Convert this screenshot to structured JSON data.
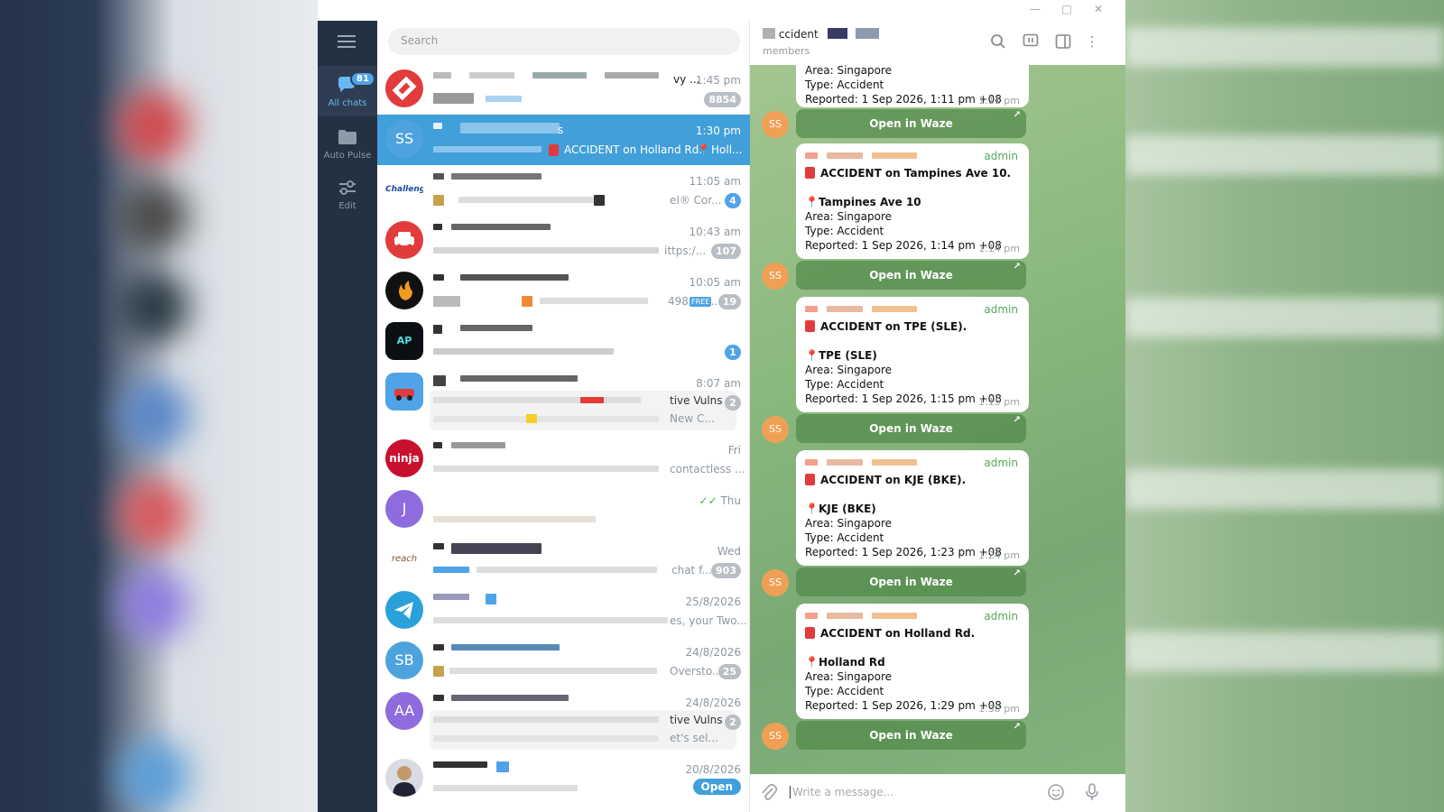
{
  "window": {
    "minimize_icon": "minimize-icon",
    "maximize_icon": "maximize-icon",
    "close_icon": "close-icon"
  },
  "sidebar": {
    "menu_icon": "hamburger-icon",
    "folders": [
      {
        "label": "All chats",
        "badge": "81",
        "icon": "chats-icon",
        "active": true
      },
      {
        "label": "Auto Pulse",
        "icon": "folder-icon"
      },
      {
        "label": "Edit",
        "icon": "sliders-icon"
      }
    ]
  },
  "chatlist": {
    "search_placeholder": "Search",
    "rows": [
      {
        "time": "1:45 pm",
        "preview": "vy ...",
        "unread": "8854"
      },
      {
        "initials": "SS",
        "time": "1:30 pm",
        "name_tail": "s",
        "preview": "ACCIDENT on Holland Rd.",
        "preview2": "Holl...",
        "selected": true
      },
      {
        "time": "11:05 am",
        "preview": "el® Cor...",
        "unread": "4"
      },
      {
        "time": "10:43 am",
        "preview": "ittps:/...",
        "unread": "107"
      },
      {
        "time": "10:05 am",
        "preview": "498",
        "preview2": "...",
        "unread": "19"
      },
      {
        "initials": "AP",
        "time": "",
        "unread": "1"
      },
      {
        "time": "8:07 am",
        "preview": "tive Vulns",
        "preview2": "New C...",
        "unread": "2"
      },
      {
        "time": "Fri",
        "preview": "contactless ..."
      },
      {
        "initials": "J",
        "time": "Thu"
      },
      {
        "time": "Wed",
        "preview": "chat f...",
        "unread": "903"
      },
      {
        "time": "25/8/2026",
        "preview": "es, your Two..."
      },
      {
        "initials": "SB",
        "time": "24/8/2026",
        "preview": "Oversto...",
        "unread": "25"
      },
      {
        "initials": "AA",
        "time": "24/8/2026",
        "preview": "tive Vulns",
        "preview2": "et's sel...",
        "unread": "2"
      },
      {
        "time": "20/8/2026",
        "open_label": "Open"
      }
    ]
  },
  "conversation": {
    "title": "ccident",
    "subtitle": "members",
    "header_icons": [
      "search-icon",
      "livestream-icon",
      "sidebar-icon",
      "more-icon"
    ],
    "top_partial": {
      "area": "Area: Singapore",
      "type": "Type: Accident",
      "reported": "Reported: 1 Sep 2026, 1:11 pm +08",
      "time": "1:11 pm"
    },
    "messages": [
      {
        "admin": "admin",
        "headline": "ACCIDENT on Tampines Ave 10.",
        "place": "Tampines Ave 10",
        "area": "Area: Singapore",
        "type": "Type: Accident",
        "reported": "Reported: 1 Sep 2026, 1:14 pm +08",
        "time": "1:14 pm"
      },
      {
        "admin": "admin",
        "headline": "ACCIDENT on TPE (SLE).",
        "place": "TPE (SLE)",
        "area": "Area: Singapore",
        "type": "Type: Accident",
        "reported": "Reported: 1 Sep 2026, 1:15 pm +08",
        "time": "1:15 pm"
      },
      {
        "admin": "admin",
        "headline": "ACCIDENT on KJE (BKE).",
        "place": "KJE (BKE)",
        "area": "Area: Singapore",
        "type": "Type: Accident",
        "reported": "Reported: 1 Sep 2026, 1:23 pm +08",
        "time": "1:24 pm"
      },
      {
        "admin": "admin",
        "headline": "ACCIDENT on Holland Rd.",
        "place": "Holland Rd",
        "area": "Area: Singapore",
        "type": "Type: Accident",
        "reported": "Reported: 1 Sep 2026, 1:29 pm +08",
        "time": "1:30 pm"
      }
    ],
    "waze_label": "Open in Waze",
    "sender_initials": "SS",
    "composer_placeholder": "Write a message...",
    "composer_icons": [
      "attach-icon",
      "emoji-icon",
      "microphone-icon"
    ]
  },
  "colors": {
    "accent": "#419fd9",
    "sidebar": "#233143",
    "admin": "#53a85a",
    "sender_avatar": "#f0a055"
  }
}
